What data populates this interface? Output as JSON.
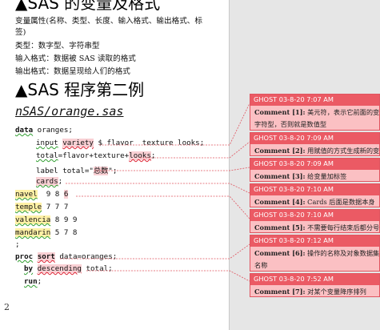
{
  "doc": {
    "heading_top": "▲SAS 的变量及格式",
    "para1_line1": "变量属性(名称、类型、长度、输入格式、输出格式、标",
    "para1_line2": "签)",
    "para2": "类型：数字型、字符串型",
    "para3": "输入格式：数据被 SAS 读取的格式",
    "para4": "输出格式：数据呈现给人们的格式",
    "heading2": "▲SAS 程序第二例",
    "subheading": "nSAS/orange.sas",
    "page_number": "2",
    "code": {
      "l1_kw": "data",
      "l1_rest": " oranges;",
      "l2_a": "input",
      "l2_b": " ",
      "l2_c": "variety",
      "l2_d": " $ flavor  texture looks;",
      "l3_a": "total",
      "l3_b": "=flavor+texture+",
      "l3_c": "looks",
      "l3_d": ";",
      "l4_a": "label total=\"",
      "l4_b": "总数",
      "l4_c": "\";",
      "l5_a": "cards",
      "l5_b": ";",
      "l6_a": "navel",
      "l6_b": "  9 8 ",
      "l6_c": "6",
      "l7_a": "temple",
      "l7_b": " 7 7 7",
      "l8_a": "valencia",
      "l8_b": " 8 9 9",
      "l9_a": "mandarin",
      "l9_b": " 5 7 8",
      "l10": ";",
      "l11_a": "proc",
      "l11_b": " ",
      "l11_c": "sort",
      "l11_d": " data=oranges;",
      "l12_a": "by",
      "l12_b": " ",
      "l12_c": "descending",
      "l12_d": " total;",
      "l13_a": "run",
      "l13_b": ";"
    }
  },
  "comments": [
    {
      "author_time": "GHOST 03-8-20 7:07 AM",
      "label": "Comment [1]:",
      "line1": " 美元符，表示它前面的变量",
      "line2": "字符型，否则就是数值型"
    },
    {
      "author_time": "GHOST 03-8-20 7:09 AM",
      "label": "Comment [2]:",
      "line1": " 用赋值的方式生成新的变量",
      "line2": ""
    },
    {
      "author_time": "GHOST 03-8-20 7:09 AM",
      "label": "Comment [3]:",
      "line1": " 给变量加标签",
      "line2": ""
    },
    {
      "author_time": "GHOST 03-8-20 7:10 AM",
      "label": "Comment [4]:",
      "line1": " Cards 后面是数据本身",
      "line2": ""
    },
    {
      "author_time": "GHOST 03-8-20 7:10 AM",
      "label": "Comment [5]:",
      "line1": " 不需要每行结束后都分号",
      "line2": ""
    },
    {
      "author_time": "GHOST 03-8-20 7:12 AM",
      "label": "Comment [6]:",
      "line1": " 操作的名称及对象数据集的",
      "line2": "名称"
    },
    {
      "author_time": "GHOST 03-8-20 7:52 AM",
      "label": "Comment [7]:",
      "line1": " 对某个变量降序排列",
      "line2": ""
    }
  ],
  "colors": {
    "comment_header": "#eb5a64",
    "comment_body": "#fbc0c3",
    "connector": "#e05560",
    "spell_green": "#2f9e2f",
    "spell_red": "#dd2233",
    "highlight_yellow": "#fff1a6"
  }
}
